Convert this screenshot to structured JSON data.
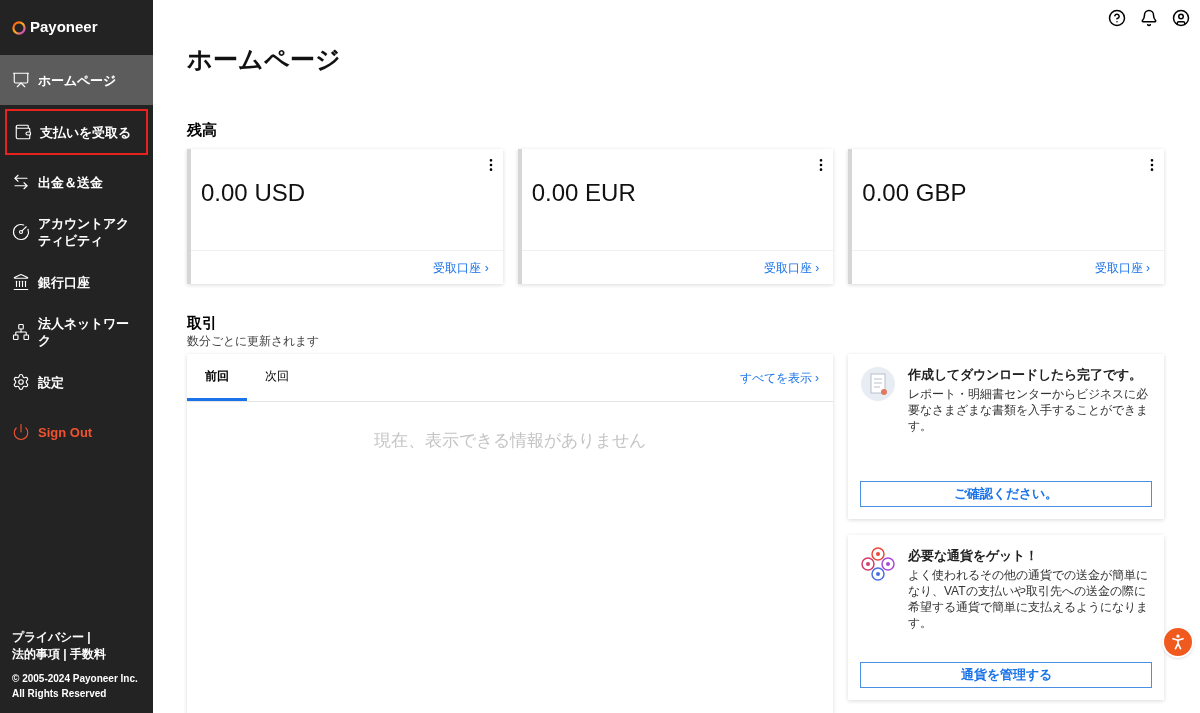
{
  "sidebar": {
    "logo": "Payoneer",
    "items": [
      {
        "label": "ホームページ",
        "selected": true,
        "outlined": false,
        "kind": "nav"
      },
      {
        "label": "支払いを受取る",
        "selected": false,
        "outlined": true,
        "kind": "nav"
      },
      {
        "label": "出金＆送金",
        "selected": false,
        "outlined": false,
        "kind": "nav"
      },
      {
        "label": "アカウントアクティビティ",
        "selected": false,
        "outlined": false,
        "kind": "nav"
      },
      {
        "label": "銀行口座",
        "selected": false,
        "outlined": false,
        "kind": "nav"
      },
      {
        "label": "法人ネットワーク",
        "selected": false,
        "outlined": false,
        "kind": "nav"
      },
      {
        "label": "設定",
        "selected": false,
        "outlined": false,
        "kind": "nav"
      },
      {
        "label": "Sign Out",
        "selected": false,
        "outlined": false,
        "kind": "signout"
      }
    ],
    "footer_links": [
      "プライバシー",
      "法的事項",
      "手数料"
    ],
    "footer_separator": "|",
    "copyright": [
      "© 2005-2024 Payoneer Inc.",
      "All Rights Reserved"
    ]
  },
  "page_title": "ホームページ",
  "balances": {
    "heading": "残高",
    "cards": [
      {
        "amount": "0.00 USD",
        "link": "受取口座 ›"
      },
      {
        "amount": "0.00 EUR",
        "link": "受取口座 ›"
      },
      {
        "amount": "0.00 GBP",
        "link": "受取口座 ›"
      }
    ]
  },
  "transactions": {
    "heading": "取引",
    "subtitle": "数分ごとに更新されます",
    "tabs": [
      {
        "label": "前回",
        "selected": true
      },
      {
        "label": "次回",
        "selected": false
      }
    ],
    "view_all": "すべてを表示 ›",
    "empty": "現在、表示できる情報がありません"
  },
  "promos": [
    {
      "title": "作成してダウンロードしたら完了です。",
      "body": "レポート・明細書センターからビジネスに必要なさまざまな書類を入手することができます。",
      "button": "ご確認ください。"
    },
    {
      "title": "必要な通貨をゲット！",
      "body": "よく使われるその他の通貨での送金が簡単になり、VATの支払いや取引先への送金の際に希望する通貨で簡単に支払えるようになります。",
      "button": "通貨を管理する"
    }
  ]
}
